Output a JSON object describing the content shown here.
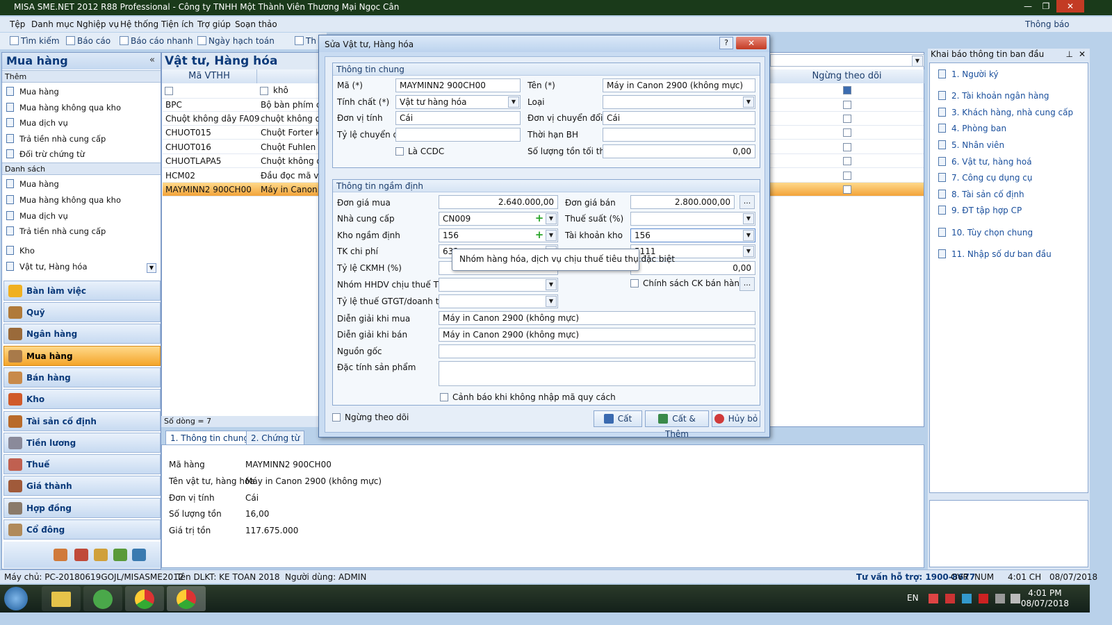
{
  "window": {
    "title": "MISA SME.NET 2012 R88 Professional - Công ty TNHH Một Thành Viên Thương Mại Ngọc Cân",
    "minimize": "—",
    "maximize": "❐",
    "close": "✕"
  },
  "menu": [
    "Tệp",
    "Danh mục",
    "Nghiệp vụ",
    "Hệ thống",
    "Tiện ích",
    "Trợ giúp",
    "Soạn thảo"
  ],
  "notification": "Thông báo",
  "toolbar": {
    "search": "Tìm kiếm",
    "report": "Báo cáo",
    "quick_report": "Báo cáo nhanh",
    "posting_date": "Ngày hạch toán",
    "more": "Th"
  },
  "left_panel": {
    "title": "Mua hàng",
    "collapse": "«",
    "section_add": "Thêm",
    "add_items": [
      "Mua hàng",
      "Mua hàng không qua kho",
      "Mua dịch vụ",
      "Trả tiền nhà cung cấp",
      "Đối trừ chứng từ"
    ],
    "section_list": "Danh sách",
    "list_items": [
      "Mua hàng",
      "Mua hàng không qua kho",
      "Mua dịch vụ",
      "Trả tiền nhà cung cấp"
    ],
    "extra_items": [
      "Kho",
      "Vật tư, Hàng hóa"
    ],
    "nav": [
      "Bàn làm việc",
      "Quỹ",
      "Ngân hàng",
      "Mua hàng",
      "Bán hàng",
      "Kho",
      "Tài sản cố định",
      "Tiền lương",
      "Thuế",
      "Giá thành",
      "Hợp đồng",
      "Cổ đông"
    ],
    "active_nav": "Mua hàng"
  },
  "grid": {
    "title": "Vật tư, Hàng hóa",
    "col_code": "Mã VTHH",
    "col_stop": "Ngừng theo dõi",
    "filter_name": "khô",
    "rows": [
      {
        "code": "BPC",
        "name": "Bộ bàn phím chuột"
      },
      {
        "code": "Chuột không dây FA09",
        "name": "chuột không dây"
      },
      {
        "code": "CHUOT015",
        "name": "Chuột Forter không dây"
      },
      {
        "code": "CHUOT016",
        "name": "Chuột Fuhlen A09"
      },
      {
        "code": "CHUOTLAPA5",
        "name": "Chuột không dây"
      },
      {
        "code": "HCM02",
        "name": "Đầu đọc mã vạch"
      },
      {
        "code": "MAYMINN2 900CH00",
        "name": "Máy in Canon 2900"
      }
    ],
    "row_count": "Số dòng = 7",
    "right_combo_label": "ai"
  },
  "detail": {
    "tabs": [
      "1. Thông tin chung",
      "2. Chứng từ"
    ],
    "fields": [
      {
        "label": "Mã hàng",
        "value": "MAYMINN2 900CH00"
      },
      {
        "label": "Tên vật tư, hàng hóa",
        "value": "Máy in Canon 2900 (không mực)"
      },
      {
        "label": "Đơn vị tính",
        "value": "Cái"
      },
      {
        "label": "Số lượng tồn",
        "value": "16,00"
      },
      {
        "label": "Giá trị tồn",
        "value": "117.675.000"
      }
    ]
  },
  "right_panel": {
    "title": "Khai báo thông tin ban đầu",
    "pin": "⊥",
    "close": "✕",
    "items": [
      "1. Người ký",
      "2. Tài khoản ngân hàng",
      "3. Khách hàng, nhà cung cấp",
      "4. Phòng ban",
      "5. Nhân viên",
      "6. Vật tư, hàng hoá",
      "7. Công cụ dụng cụ",
      "8. Tài sản cố định",
      "9. ĐT tập hợp CP",
      "10. Tùy chọn chung",
      "11. Nhập số dư ban đầu"
    ]
  },
  "status": {
    "server": "Máy chủ: PC-20180619GOJL/MISASME2012",
    "db": "Tên DLKT: KE TOAN 2018",
    "user": "Người dùng: ADMIN",
    "support": "Tư vấn hỗ trợ: 1900-8677",
    "ovr": "OVR",
    "num": "NUM",
    "time": "4:01 CH",
    "date": "08/07/2018"
  },
  "taskbar": {
    "lang": "EN",
    "clock_time": "4:01 PM",
    "clock_date": "08/07/2018"
  },
  "dialog": {
    "title": "Sửa Vật tư, Hàng hóa",
    "help": "?",
    "close": "✕",
    "general": {
      "title": "Thông tin chung",
      "code_label": "Mã (*)",
      "code": "MAYMINN2 900CH00",
      "name_label": "Tên (*)",
      "name": "Máy in Canon 2900 (không mực)",
      "nature_label": "Tính chất (*)",
      "nature": "Vật tư hàng hóa",
      "type_label": "Loại",
      "type": "",
      "unit_label": "Đơn vị tính",
      "unit": "Cái",
      "conv_unit_label": "Đơn vị chuyển đổi",
      "conv_unit": "Cái",
      "conv_rate_label": "Tỷ lệ chuyển đổi",
      "conv_rate": "",
      "warranty_label": "Thời hạn BH",
      "warranty": "",
      "ccdc_label": "Là CCDC",
      "min_stock_label": "Số lượng tồn tối thiểu",
      "min_stock": "0,00"
    },
    "default": {
      "title": "Thông tin ngầm định",
      "buy_price_label": "Đơn giá mua",
      "buy_price": "2.640.000,00",
      "sell_price_label": "Đơn giá bán",
      "sell_price": "2.800.000,00",
      "supplier_label": "Nhà cung cấp",
      "supplier": "CN009",
      "tax_rate_label": "Thuế suất (%)",
      "tax_rate": "",
      "warehouse_label": "Kho ngầm định",
      "warehouse": "156",
      "stock_account_label": "Tài khoản kho",
      "stock_account": "156",
      "cost_account_label": "TK chi phí",
      "cost_account": "632",
      "revenue_account_value": "5111",
      "discount_label": "Tỷ lệ CKMH (%)",
      "discount": "",
      "discount_amount": "0,00",
      "excise_group_label": "Nhóm HHDV chịu thuế TTĐB",
      "excise_group": "",
      "policy_label": "Chính sách CK bán hàng",
      "vat_rate_label": "Tỷ lệ thuế GTGT/doanh thu",
      "vat_rate": "",
      "buy_desc_label": "Diễn giải khi mua",
      "buy_desc": "Máy in Canon 2900 (không mực)",
      "sell_desc_label": "Diễn giải khi bán",
      "sell_desc": "Máy in Canon 2900 (không mực)",
      "origin_label": "Nguồn gốc",
      "origin": "",
      "feature_label": "Đặc tính sản phẩm",
      "feature": "",
      "warn_label": "Cảnh báo khi không nhập mã quy cách"
    },
    "stop_tracking_label": "Ngừng theo dõi",
    "tooltip": "Nhóm hàng hóa, dịch vụ chịu thuế tiêu thụ đặc biệt",
    "buttons": {
      "save": "Cất",
      "save_add": "Cất & Thêm",
      "cancel": "Hủy bỏ"
    },
    "ellipsis": "..."
  }
}
